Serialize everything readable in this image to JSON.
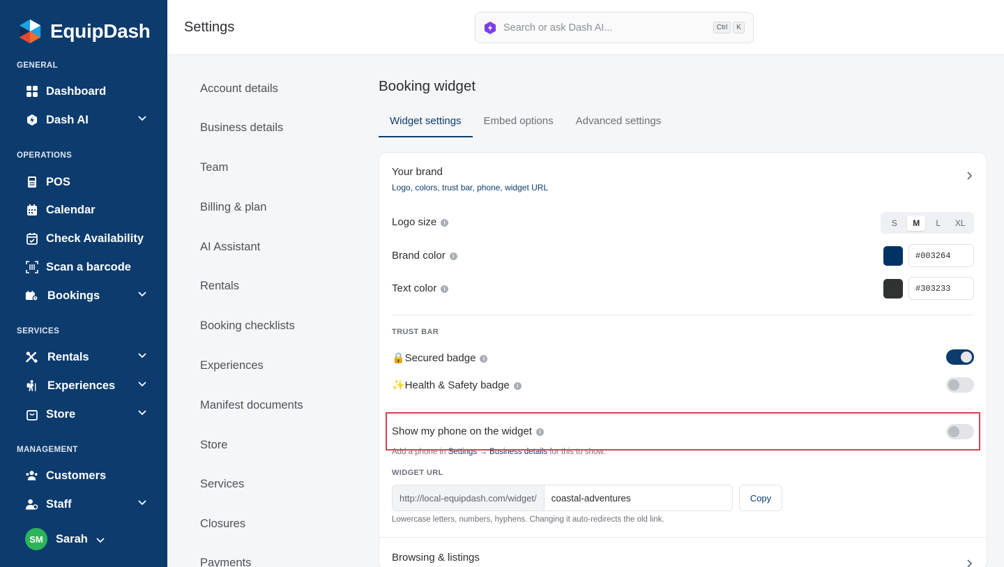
{
  "app": {
    "name": "EquipDash"
  },
  "sidebar": {
    "sections": {
      "general": "GENERAL",
      "operations": "OPERATIONS",
      "services": "SERVICES",
      "management": "MANAGEMENT"
    },
    "items": {
      "dashboard": "Dashboard",
      "dash_ai": "Dash AI",
      "pos": "POS",
      "calendar": "Calendar",
      "check_availability": "Check Availability",
      "scan_barcode": "Scan a barcode",
      "bookings": "Bookings",
      "rentals": "Rentals",
      "experiences": "Experiences",
      "store": "Store",
      "customers": "Customers",
      "staff": "Staff"
    },
    "user": {
      "initials": "SM",
      "name": "Sarah"
    }
  },
  "header": {
    "title": "Settings",
    "search_placeholder": "Search or ask Dash AI...",
    "shortcut_ctrl": "Ctrl",
    "shortcut_key": "K"
  },
  "settings_nav": [
    "Account details",
    "Business details",
    "Team",
    "Billing & plan",
    "AI Assistant",
    "Rentals",
    "Booking checklists",
    "Experiences",
    "Manifest documents",
    "Store",
    "Services",
    "Closures",
    "Payments"
  ],
  "main": {
    "title": "Booking widget",
    "tabs": [
      "Widget settings",
      "Embed options",
      "Advanced settings"
    ],
    "active_tab": 0,
    "brand": {
      "title": "Your brand",
      "subtitle": "Logo, colors, trust bar, phone, widget URL",
      "logo_size_label": "Logo size",
      "logo_sizes": [
        "S",
        "M",
        "L",
        "XL"
      ],
      "logo_size_selected": "M",
      "brand_color_label": "Brand color",
      "brand_color": "#003264",
      "text_color_label": "Text color",
      "text_color": "#303233"
    },
    "trust_bar": {
      "heading": "TRUST BAR",
      "secured_badge": "🔒Secured badge",
      "secured_badge_on": true,
      "health_badge": "✨Health & Safety badge",
      "health_badge_on": false
    },
    "phone": {
      "label": "Show my phone on the widget",
      "enabled": false,
      "hint_prefix": "Add a phone in ",
      "hint_link": "Settings → Business details",
      "hint_suffix": " for this to show."
    },
    "widget_url": {
      "heading": "WIDGET URL",
      "prefix": "http://local-equipdash.com/widget/",
      "slug": "coastal-adventures",
      "copy_label": "Copy",
      "hint": "Lowercase letters, numbers, hyphens. Changing it auto-redirects the old link."
    },
    "browsing": {
      "title": "Browsing & listings"
    }
  },
  "colors": {
    "sidebar_bg": "#0c3b6e",
    "accent": "#0c3b6e",
    "highlight": "#d84152"
  }
}
